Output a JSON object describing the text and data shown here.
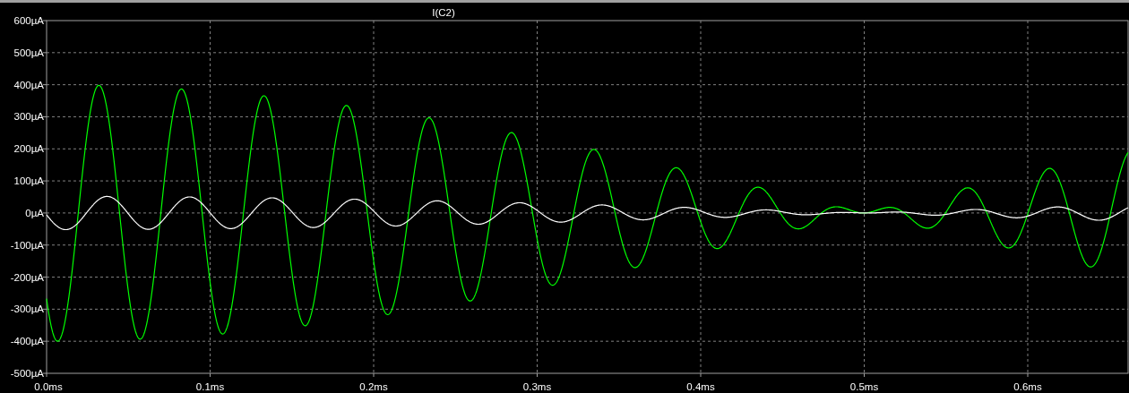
{
  "plot": {
    "title": "I(C2)",
    "y_ticks": [
      "600µA",
      "500µA",
      "400µA",
      "300µA",
      "200µA",
      "100µA",
      "0µA",
      "-100µA",
      "-200µA",
      "-300µA",
      "-400µA",
      "-500µA"
    ],
    "x_ticks": [
      "0.0ms",
      "0.1ms",
      "0.2ms",
      "0.3ms",
      "0.4ms",
      "0.5ms",
      "0.6ms"
    ],
    "traces": [
      {
        "color": "#00ff00"
      },
      {
        "color": "#ffffff"
      }
    ]
  }
}
